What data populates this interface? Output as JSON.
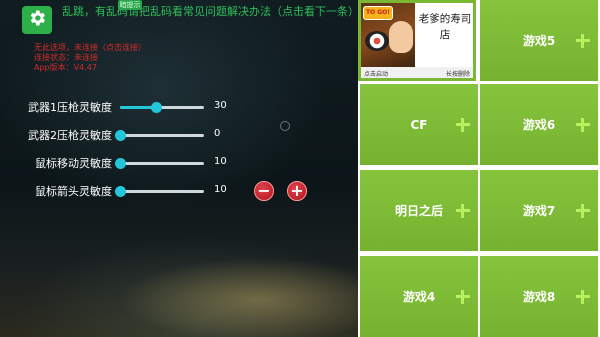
{
  "header": {
    "marquee": "乱跳，有乱码请把乱码看常见问题解决办法（点击看下一条）",
    "badge": "暗提示"
  },
  "info": [
    "无此选项，未连接（点击连接）",
    "连接状态：未连接",
    "App版本：V4.47"
  ],
  "settings": [
    {
      "label": "武器1压枪灵敏度",
      "value": "30",
      "fraction": 0.43
    },
    {
      "label": "武器2压枪灵敏度",
      "value": "0",
      "fraction": 0.0
    },
    {
      "label": "鼠标移动灵敏度",
      "value": "10",
      "fraction": 0.0
    },
    {
      "label": "鼠标箭头灵敏度",
      "value": "10",
      "fraction": 0.0
    }
  ],
  "buttons": {
    "minus": "−",
    "plus": "+"
  },
  "featured_game": {
    "title": "老爹的寿司店",
    "thumb_badge": "TO GO!",
    "launch": "点击启动",
    "delete": "长按删除"
  },
  "games": [
    "游戏5",
    "CF",
    "游戏6",
    "明日之后",
    "游戏7",
    "游戏4",
    "游戏8"
  ],
  "colors": {
    "tile": "#7ab833",
    "accent": "#26c6da",
    "danger": "#c81d1d",
    "marquee": "#2fbf5a"
  }
}
